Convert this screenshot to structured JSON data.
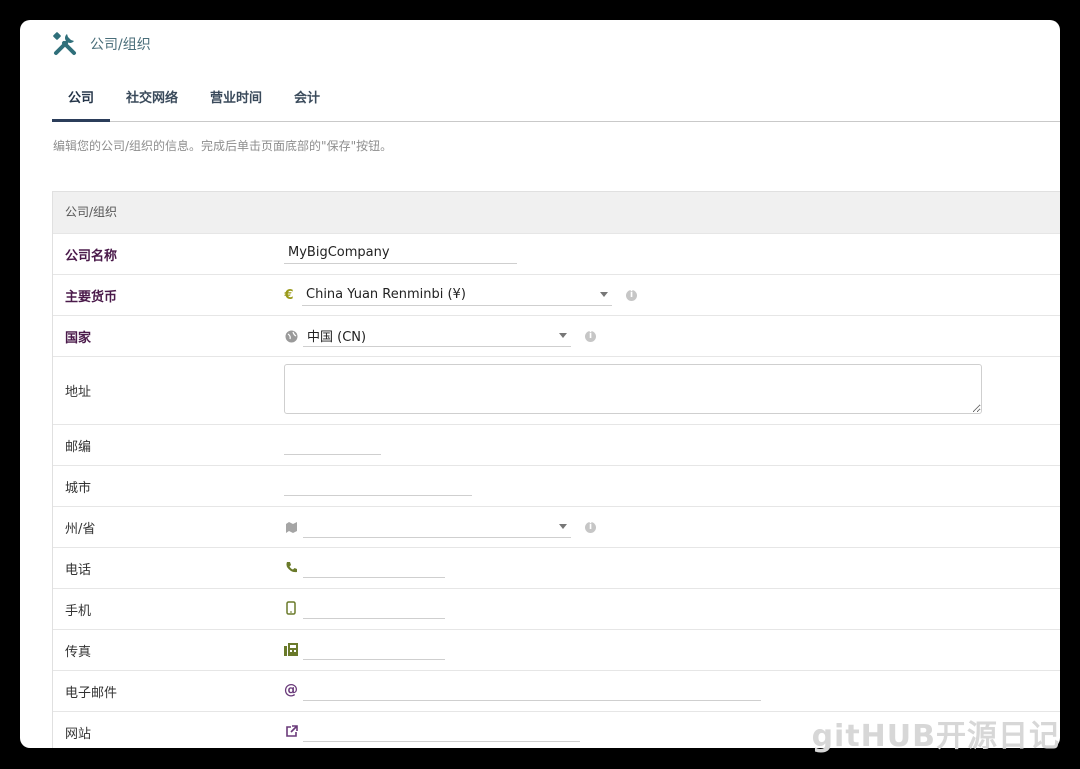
{
  "header": {
    "title": "公司/组织",
    "icon": "tools-icon",
    "icon_color": "#2f6f7a"
  },
  "tabs": [
    {
      "label": "公司",
      "active": true
    },
    {
      "label": "社交网络",
      "active": false
    },
    {
      "label": "营业时间",
      "active": false
    },
    {
      "label": "会计",
      "active": false
    }
  ],
  "description": "编辑您的公司/组织的信息。完成后单击页面底部的\"保存\"按钮。",
  "panel": {
    "title": "公司/组织",
    "fields": {
      "name": {
        "label": "公司名称",
        "value": "MyBigCompany",
        "required": true
      },
      "currency": {
        "label": "主要货币",
        "value": "China Yuan Renminbi (¥)",
        "icon": "euro-icon",
        "required": true
      },
      "country": {
        "label": "国家",
        "value": "中国 (CN)",
        "icon": "globe-icon",
        "required": true
      },
      "address": {
        "label": "地址",
        "value": ""
      },
      "zip": {
        "label": "邮编",
        "value": ""
      },
      "city": {
        "label": "城市",
        "value": ""
      },
      "state": {
        "label": "州/省",
        "value": "",
        "icon": "map-icon"
      },
      "phone": {
        "label": "电话",
        "value": "",
        "icon": "phone-icon"
      },
      "mobile": {
        "label": "手机",
        "value": "",
        "icon": "mobile-icon"
      },
      "fax": {
        "label": "传真",
        "value": "",
        "icon": "fax-icon"
      },
      "email": {
        "label": "电子邮件",
        "value": "",
        "icon": "at-icon"
      },
      "website": {
        "label": "网站",
        "value": "",
        "icon": "external-link-icon"
      }
    }
  },
  "watermark": "gitHUB开源日记",
  "colors": {
    "required_label": "#4a1a4a",
    "icon_green": "#7a7a2a",
    "icon_purple": "#6a3a7a",
    "tab_underline": "#2b3d5a"
  }
}
